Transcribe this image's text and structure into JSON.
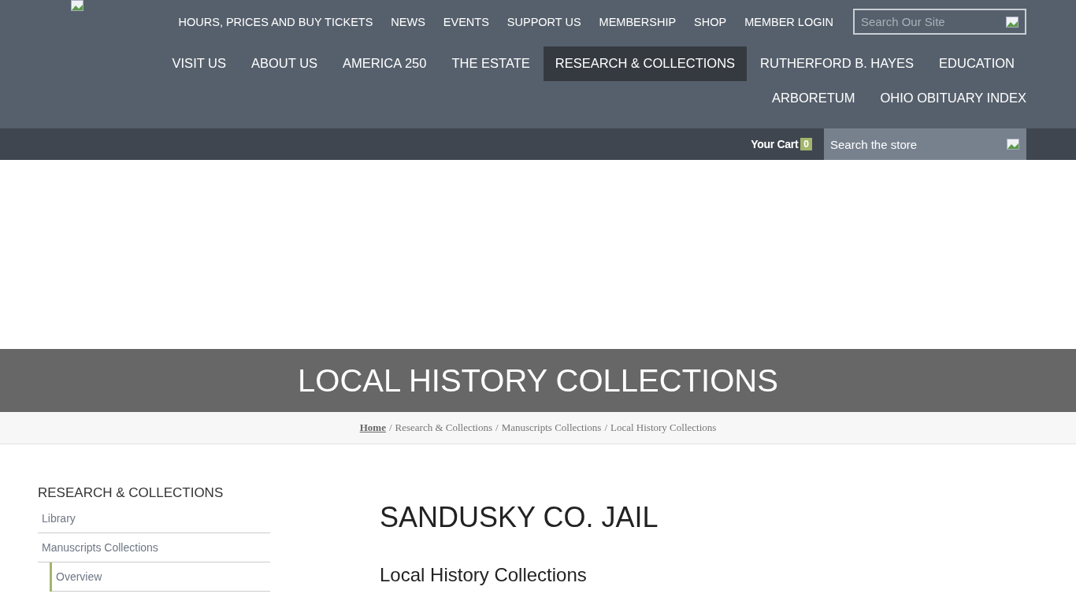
{
  "utility_nav": [
    "HOURS, PRICES AND BUY TICKETS",
    "NEWS",
    "EVENTS",
    "SUPPORT US",
    "MEMBERSHIP",
    "SHOP",
    "MEMBER LOGIN"
  ],
  "site_search": {
    "placeholder": "Search Our Site"
  },
  "main_nav": [
    {
      "label": "VISIT US",
      "selected": false
    },
    {
      "label": "ABOUT US",
      "selected": false
    },
    {
      "label": "AMERICA 250",
      "selected": false
    },
    {
      "label": "THE ESTATE",
      "selected": false
    },
    {
      "label": "RESEARCH & COLLECTIONS",
      "selected": true
    },
    {
      "label": "RUTHERFORD B. HAYES",
      "selected": false
    },
    {
      "label": "EDUCATION",
      "selected": false
    },
    {
      "label": "ARBORETUM",
      "selected": false
    },
    {
      "label": "OHIO OBITUARY INDEX",
      "selected": false
    }
  ],
  "cart": {
    "label": "Your Cart",
    "count": "0"
  },
  "store_search": {
    "placeholder": "Search the store"
  },
  "page_title": "LOCAL HISTORY COLLECTIONS",
  "breadcrumb": {
    "separator": "/",
    "items": [
      "Home",
      "Research & Collections",
      "Manuscripts Collections",
      "Local History Collections"
    ]
  },
  "sidebar": {
    "title": "RESEARCH & COLLECTIONS",
    "items": [
      {
        "label": "Library"
      },
      {
        "label": "Manuscripts Collections",
        "children": [
          {
            "label": "Overview"
          }
        ]
      }
    ]
  },
  "content": {
    "title": "SANDUSKY CO. JAIL",
    "subtitle": "Local History Collections"
  }
}
